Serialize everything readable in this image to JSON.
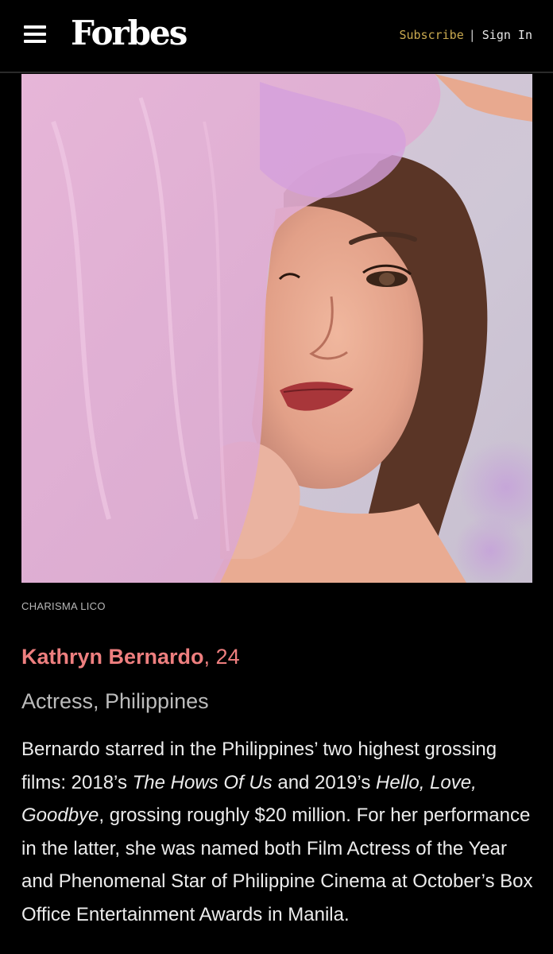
{
  "header": {
    "logo": "Forbes",
    "subscribe_label": "Subscribe",
    "separator": "|",
    "signin_label": "Sign In",
    "icons": {
      "menu": "hamburger-menu-icon"
    }
  },
  "photo": {
    "credit": "CHARISMA LICO"
  },
  "profile": {
    "name": "Kathryn Bernardo",
    "age": ", 24",
    "subtitle": "Actress, Philippines",
    "bio": {
      "p1": "Bernardo starred in the Philippines’ two highest grossing films: 2018’s ",
      "film1": "The Hows Of Us",
      "p2": " and 2019’s ",
      "film2": "Hello, Love, Goodbye",
      "p3": ", grossing roughly $20 million. For her performance in the latter, she was named both Film Actress of the Year and Phenomenal Star of Philippine Cinema at October’s Box Office Entertainment Awards in Manila."
    }
  },
  "colors": {
    "background": "#000000",
    "accent_subscribe": "#c9a94f",
    "name_color": "#ee7f7f"
  }
}
